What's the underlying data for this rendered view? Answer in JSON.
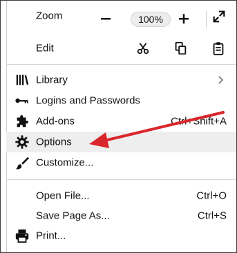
{
  "menu": {
    "zoom": {
      "label": "Zoom",
      "level": "100%",
      "minus_symbol": "−",
      "plus_symbol": "+"
    },
    "edit": {
      "label": "Edit"
    },
    "items": {
      "library": "Library",
      "logins": "Logins and Passwords",
      "addons": "Add-ons",
      "options": "Options",
      "customize": "Customize...",
      "open_file": "Open File...",
      "save_page": "Save Page As...",
      "print": "Print..."
    },
    "shortcuts": {
      "addons": "Ctrl+Shift+A",
      "open_file": "Ctrl+O",
      "save_page": "Ctrl+S"
    }
  },
  "colors": {
    "accent_arrow": "#d9262b",
    "highlight_row": "#eeeeee",
    "text": "#111111",
    "separator": "#d7d7d7"
  },
  "icons": {
    "zoom_out": "minus-icon",
    "zoom_in": "plus-icon",
    "fullscreen": "fullscreen-icon",
    "cut": "scissors-icon",
    "copy": "copy-icon",
    "paste": "clipboard-icon",
    "library": "library-icon",
    "logins": "key-icon",
    "addons": "puzzle-icon",
    "options": "gear-icon",
    "customize": "paintbrush-icon",
    "print": "printer-icon",
    "library_submenu": "chevron-right-icon"
  }
}
